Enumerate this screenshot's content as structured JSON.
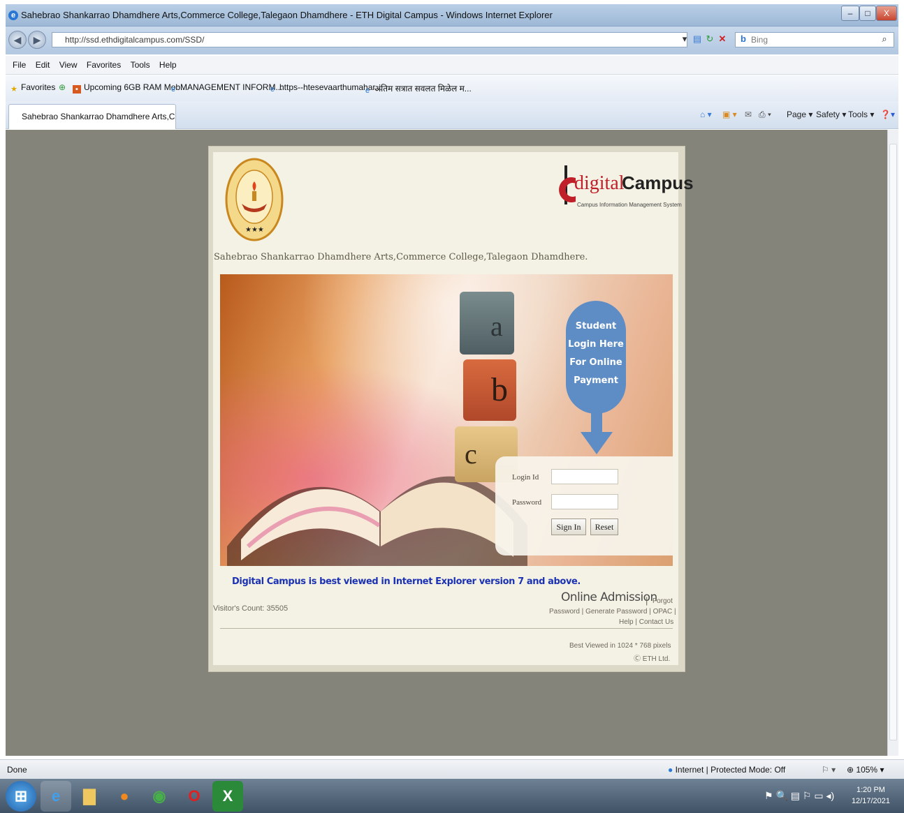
{
  "window": {
    "title": "Sahebrao Shankarrao Dhamdhere Arts,Commerce College,Talegaon Dhamdhere - ETH Digital Campus - Windows Internet Explorer",
    "min": "–",
    "max": "□",
    "close": "X"
  },
  "address": {
    "url": "http://ssd.ethdigitalcampus.com/SSD/",
    "search_placeholder": "Bing",
    "search_icon": "search-icon"
  },
  "menu": [
    "File",
    "Edit",
    "View",
    "Favorites",
    "Tools",
    "Help"
  ],
  "favorites": {
    "label": "Favorites",
    "items": [
      "Upcoming 6GB RAM Mob...",
      "MANAGEMENT INFORM...",
      "https--htesevaarthumahar...",
      "अंतिम सत्रात सवलत मिळेल म..."
    ]
  },
  "tab": {
    "label": "Sahebrao Shankarrao Dhamdhere Arts,Commerc..."
  },
  "commands": {
    "page": "Page ▾",
    "safety": "Safety ▾",
    "tools": "Tools ▾"
  },
  "page": {
    "college_name": "Sahebrao Shankarrao Dhamdhere Arts,Commerce College,Talegaon Dhamdhere.",
    "brand": {
      "word1": "digital",
      "word2": "Campus",
      "tagline": "Campus Information Management System"
    },
    "banner": {
      "badge": [
        "Student",
        "Login Here",
        "For Online",
        "Payment"
      ],
      "cube_letters": [
        "a",
        "b",
        "c"
      ]
    },
    "login": {
      "login_id_label": "Login Id",
      "login_id_value": "",
      "password_label": "Password",
      "password_value": "",
      "sign_in": "Sign In",
      "reset": "Reset"
    },
    "best_viewed_ie": "Digital Campus is best viewed in Internet Explorer version 7 and above.",
    "visitor_count": "Visitor's Count: 35505",
    "online_admission": "Online Admission",
    "links": {
      "forgot": "Forgot",
      "password": "Password",
      "generate_password": "Generate Password",
      "opac": "OPAC",
      "help": "Help",
      "contact_us": "Contact Us"
    },
    "footer_resolution": "Best Viewed in 1024 * 768 pixels",
    "footer_company": "Ⓒ ETH Ltd."
  },
  "status": {
    "left": "Done",
    "zone": "Internet | Protected Mode: Off",
    "zoom": "105%"
  },
  "taskbar": {
    "time": "1:20 PM",
    "date": "12/17/2021"
  },
  "colors": {
    "desktop_bg": "#85847a",
    "brand_red": "#c0202a",
    "link_blue": "#1c32b4",
    "badge_blue": "#5e8cc4"
  }
}
